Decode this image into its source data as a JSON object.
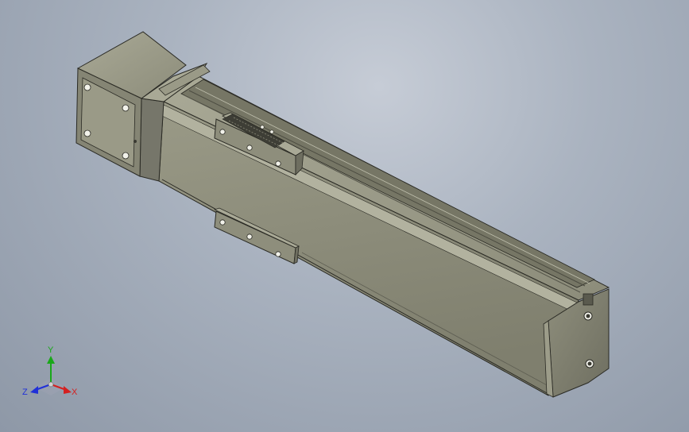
{
  "viewport": {
    "background_top": "#c6ccd6",
    "background_bottom": "#8e98a7"
  },
  "model": {
    "body_color": "#8a8a78",
    "body_dark": "#6b6b5c",
    "body_light": "#a3a391",
    "edge_color": "#2a2a24"
  },
  "triad": {
    "x_label": "X",
    "y_label": "Y",
    "z_label": "Z",
    "x_color": "#d42020",
    "y_color": "#1aa81a",
    "z_color": "#2030d8"
  }
}
